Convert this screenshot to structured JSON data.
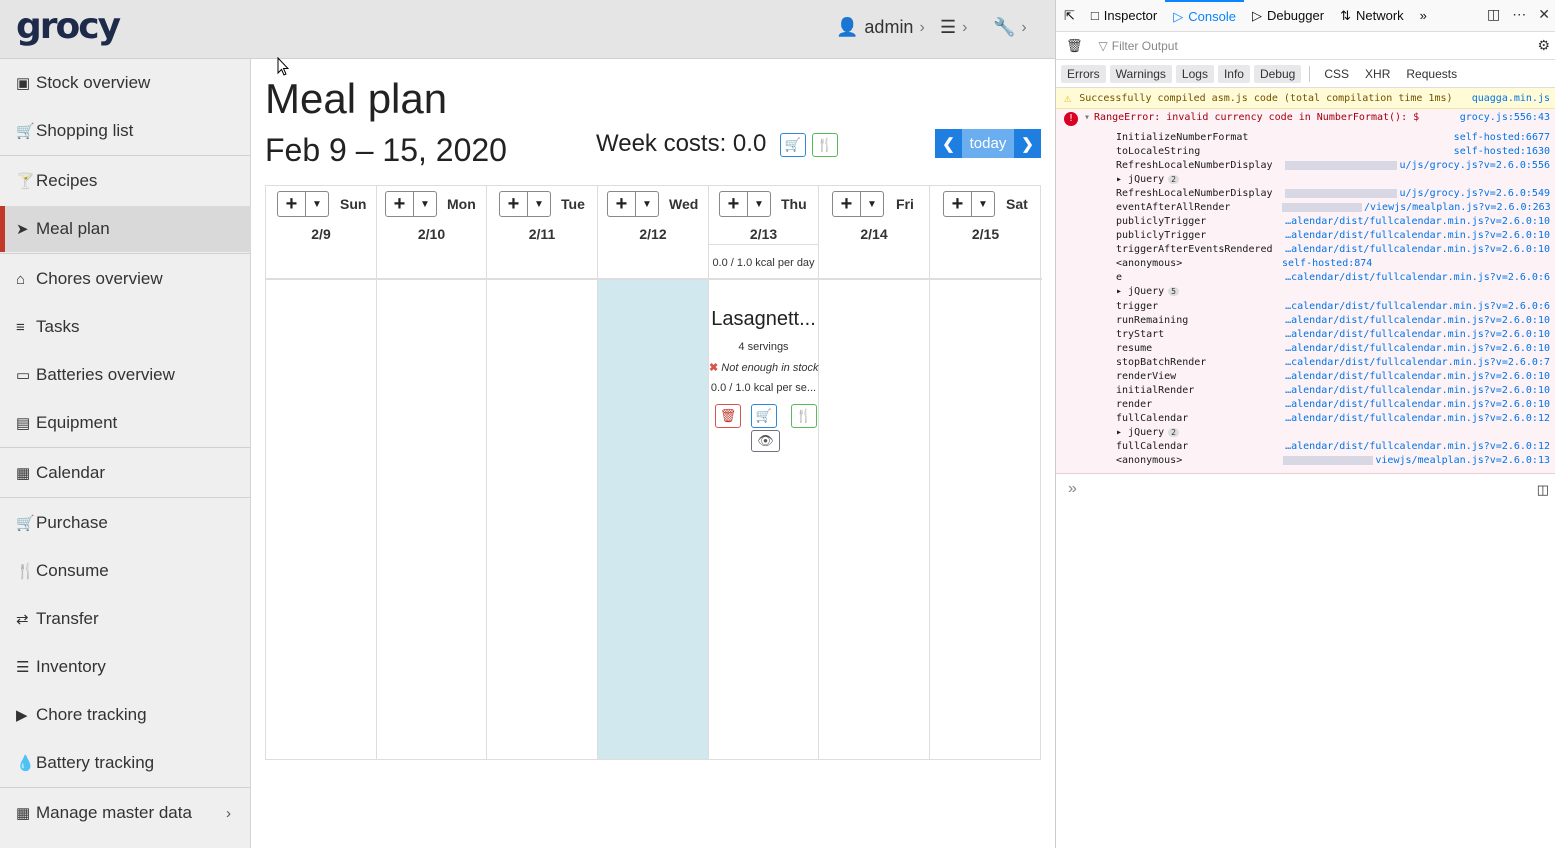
{
  "app": {
    "brand": "grocy",
    "user": "admin"
  },
  "sidebar": {
    "items": [
      {
        "label": "Stock overview",
        "icon": "box-icon"
      },
      {
        "label": "Shopping list",
        "icon": "cart-icon"
      },
      {
        "label": "Recipes",
        "icon": "cocktail-icon"
      },
      {
        "label": "Meal plan",
        "icon": "paper-plane-icon"
      },
      {
        "label": "Chores overview",
        "icon": "home-icon"
      },
      {
        "label": "Tasks",
        "icon": "tasks-icon"
      },
      {
        "label": "Batteries overview",
        "icon": "battery-icon"
      },
      {
        "label": "Equipment",
        "icon": "toolbox-icon"
      },
      {
        "label": "Calendar",
        "icon": "calendar-icon"
      },
      {
        "label": "Purchase",
        "icon": "cart-icon"
      },
      {
        "label": "Consume",
        "icon": "utensils-icon"
      },
      {
        "label": "Transfer",
        "icon": "exchange-icon"
      },
      {
        "label": "Inventory",
        "icon": "list-icon"
      },
      {
        "label": "Chore tracking",
        "icon": "play-icon"
      },
      {
        "label": "Battery tracking",
        "icon": "fire-icon"
      },
      {
        "label": "Manage master data",
        "icon": "table-icon"
      }
    ]
  },
  "main": {
    "title": "Meal plan",
    "week_range": "Feb 9 – 15, 2020",
    "week_costs": "Week costs: 0.0",
    "today_label": "today",
    "days": [
      {
        "name": "Sun",
        "date": "2/9"
      },
      {
        "name": "Mon",
        "date": "2/10"
      },
      {
        "name": "Tue",
        "date": "2/11"
      },
      {
        "name": "Wed",
        "date": "2/12"
      },
      {
        "name": "Thu",
        "date": "2/13",
        "kcal": "0.0 / 1.0 kcal per day"
      },
      {
        "name": "Fri",
        "date": "2/14"
      },
      {
        "name": "Sat",
        "date": "2/15"
      }
    ],
    "event": {
      "title": "Lasagnett...",
      "servings": "4 servings",
      "stock": "Not enough in stock",
      "kcal": "0.0 / 1.0 kcal per se..."
    }
  },
  "devtools": {
    "tabs": [
      "Inspector",
      "Console",
      "Debugger",
      "Network"
    ],
    "filter_placeholder": "Filter Output",
    "categories": [
      "Errors",
      "Warnings",
      "Logs",
      "Info",
      "Debug",
      "CSS",
      "XHR",
      "Requests"
    ],
    "warning": {
      "text": "Successfully compiled asm.js code (total compilation time 1ms)",
      "source": "quagga.min.js"
    },
    "error": {
      "text": "RangeError: invalid currency code in NumberFormat(): $",
      "source": "grocy.js:556:43"
    },
    "frames": [
      {
        "fn": "InitializeNumberFormat",
        "loc": "self-hosted:6677"
      },
      {
        "fn": "toLocaleString",
        "loc": "self-hosted:1630"
      },
      {
        "fn": "RefreshLocaleNumberDisplay",
        "loc": "u/js/grocy.js?v=2.6.0:556"
      },
      {
        "fn": "jQuery",
        "loc": "",
        "count": "2"
      },
      {
        "fn": "RefreshLocaleNumberDisplay",
        "loc": "u/js/grocy.js?v=2.6.0:549"
      },
      {
        "fn": "eventAfterAllRender",
        "loc": "/viewjs/mealplan.js?v=2.6.0:263"
      },
      {
        "fn": "publiclyTrigger",
        "loc": "…alendar/dist/fullcalendar.min.js?v=2.6.0:10"
      },
      {
        "fn": "publiclyTrigger",
        "loc": "…alendar/dist/fullcalendar.min.js?v=2.6.0:10"
      },
      {
        "fn": "triggerAfterEventsRendered",
        "loc": "…alendar/dist/fullcalendar.min.js?v=2.6.0:10"
      },
      {
        "fn": "<anonymous>",
        "loc": "self-hosted:874"
      },
      {
        "fn": "e",
        "loc": "…calendar/dist/fullcalendar.min.js?v=2.6.0:6"
      },
      {
        "fn": "jQuery",
        "loc": "",
        "count": "5"
      },
      {
        "fn": "trigger",
        "loc": "…calendar/dist/fullcalendar.min.js?v=2.6.0:6"
      },
      {
        "fn": "runRemaining",
        "loc": "…alendar/dist/fullcalendar.min.js?v=2.6.0:10"
      },
      {
        "fn": "tryStart",
        "loc": "…alendar/dist/fullcalendar.min.js?v=2.6.0:10"
      },
      {
        "fn": "resume",
        "loc": "…alendar/dist/fullcalendar.min.js?v=2.6.0:10"
      },
      {
        "fn": "stopBatchRender",
        "loc": "…calendar/dist/fullcalendar.min.js?v=2.6.0:7"
      },
      {
        "fn": "renderView",
        "loc": "…alendar/dist/fullcalendar.min.js?v=2.6.0:10"
      },
      {
        "fn": "initialRender",
        "loc": "…alendar/dist/fullcalendar.min.js?v=2.6.0:10"
      },
      {
        "fn": "render",
        "loc": "…alendar/dist/fullcalendar.min.js?v=2.6.0:10"
      },
      {
        "fn": "fullCalendar",
        "loc": "…alendar/dist/fullcalendar.min.js?v=2.6.0:12"
      },
      {
        "fn": "jQuery",
        "loc": "",
        "count": "2"
      },
      {
        "fn": "fullCalendar",
        "loc": "…alendar/dist/fullcalendar.min.js?v=2.6.0:12"
      },
      {
        "fn": "<anonymous>",
        "loc": "viewjs/mealplan.js?v=2.6.0:13"
      }
    ]
  }
}
